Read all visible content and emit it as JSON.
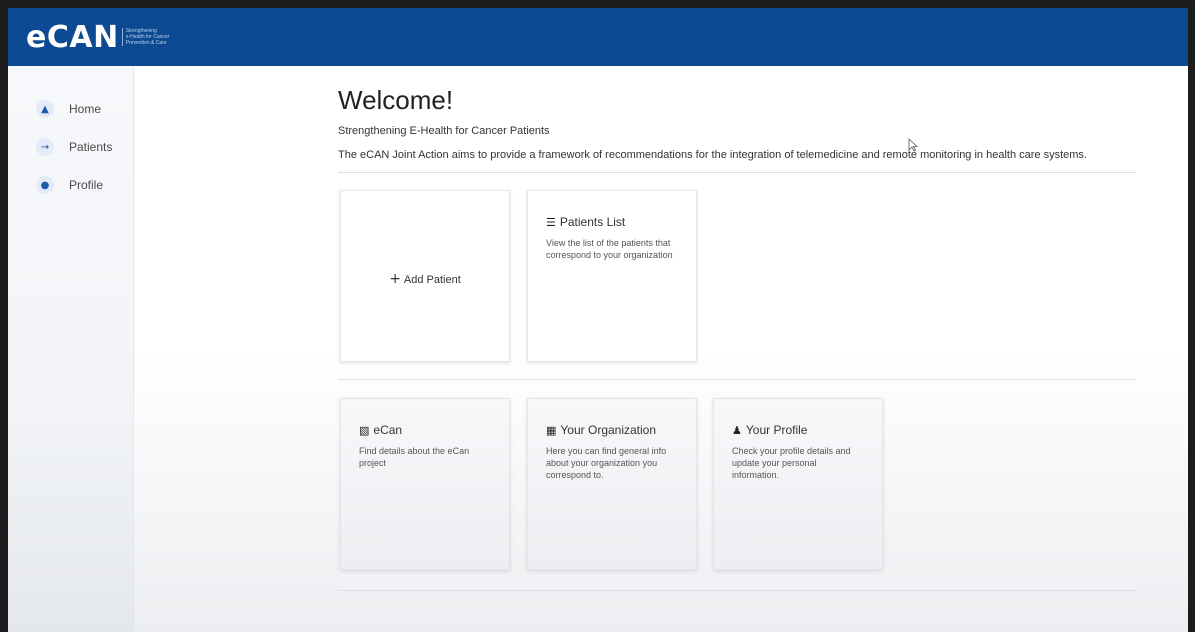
{
  "brand": {
    "name": "eCAN",
    "tagline": [
      "Strengthening",
      "e-Health for Cancer",
      "Prevention & Care"
    ]
  },
  "sidebar": {
    "items": [
      {
        "label": "Home",
        "icon": "home-icon"
      },
      {
        "label": "Patients",
        "icon": "arrow-right-icon"
      },
      {
        "label": "Profile",
        "icon": "person-icon"
      }
    ]
  },
  "main": {
    "title": "Welcome!",
    "subtitle": "Strengthening E-Health for Cancer Patients",
    "description": "The eCAN Joint Action aims to provide a framework of recommendations for the integration of telemedicine and remote monitoring in health care systems."
  },
  "cards_top": {
    "add_patient": {
      "label": "Add Patient"
    },
    "patients_list": {
      "title": "Patients List",
      "text": "View the list of the patients that correspond to your organization"
    }
  },
  "cards_bottom": {
    "ecan": {
      "title": "eCan",
      "text": "Find details about the eCan project"
    },
    "organization": {
      "title": "Your Organization",
      "text": "Here you can find general info about your organization you correspond to."
    },
    "profile": {
      "title": "Your Profile",
      "text": "Check your profile details and update your personal information."
    }
  },
  "colors": {
    "topbar": "#0d4a94",
    "accent": "#1d5aa6"
  }
}
